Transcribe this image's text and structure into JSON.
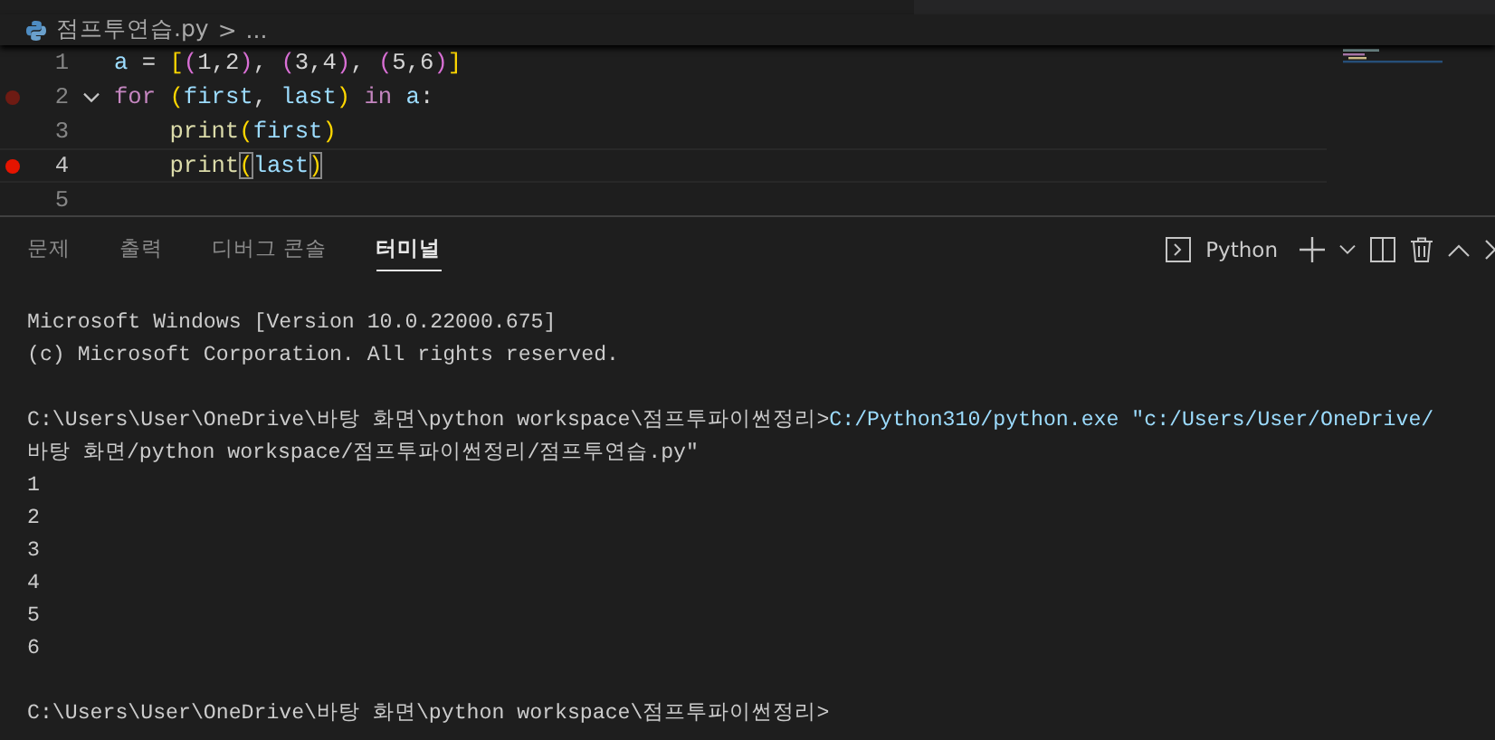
{
  "breadcrumb": {
    "file": "점프투연습.py",
    "separator": ">",
    "more": "..."
  },
  "editor": {
    "lines": [
      {
        "number": "1",
        "current": false,
        "fold": false,
        "tokens": [
          {
            "kind": "var",
            "text": "a"
          },
          {
            "kind": "op",
            "text": " = "
          },
          {
            "kind": "b1",
            "text": "["
          },
          {
            "kind": "b2",
            "text": "("
          },
          {
            "kind": "num",
            "text": "1,2"
          },
          {
            "kind": "b2",
            "text": ")"
          },
          {
            "kind": "op",
            "text": ", "
          },
          {
            "kind": "b2",
            "text": "("
          },
          {
            "kind": "num",
            "text": "3,4"
          },
          {
            "kind": "b2",
            "text": ")"
          },
          {
            "kind": "op",
            "text": ", "
          },
          {
            "kind": "b2",
            "text": "("
          },
          {
            "kind": "num",
            "text": "5,6"
          },
          {
            "kind": "b2",
            "text": ")"
          },
          {
            "kind": "b1",
            "text": "]"
          }
        ]
      },
      {
        "number": "2",
        "breakpoint": {
          "active": false
        },
        "current": false,
        "fold": true,
        "tokens": [
          {
            "kind": "kw",
            "text": "for "
          },
          {
            "kind": "b1",
            "text": "("
          },
          {
            "kind": "var",
            "text": "first"
          },
          {
            "kind": "op",
            "text": ", "
          },
          {
            "kind": "var",
            "text": "last"
          },
          {
            "kind": "b1",
            "text": ")"
          },
          {
            "kind": "kw",
            "text": " in "
          },
          {
            "kind": "var",
            "text": "a"
          },
          {
            "kind": "op",
            "text": ":"
          }
        ]
      },
      {
        "number": "3",
        "current": false,
        "fold": false,
        "tokens": [
          {
            "kind": "fn",
            "text": "    print"
          },
          {
            "kind": "b1",
            "text": "("
          },
          {
            "kind": "var",
            "text": "first"
          },
          {
            "kind": "b1",
            "text": ")"
          }
        ]
      },
      {
        "number": "4",
        "breakpoint": {
          "active": true
        },
        "current": true,
        "fold": false,
        "tokens": [
          {
            "kind": "fn",
            "text": "    print"
          },
          {
            "kind": "match",
            "text": "("
          },
          {
            "kind": "var",
            "text": "last"
          },
          {
            "kind": "match",
            "text": ")"
          }
        ]
      },
      {
        "number": "5",
        "current": false,
        "fold": false
      }
    ]
  },
  "panel": {
    "tabs": [
      {
        "label": "문제",
        "selected": false
      },
      {
        "label": "출력",
        "selected": false
      },
      {
        "label": "디버그 콘솔",
        "selected": false
      },
      {
        "label": "터미널",
        "selected": true
      }
    ],
    "terminal_name": "Python",
    "terminal_lines": [
      {
        "segments": [
          {
            "kind": "plain",
            "text": "Microsoft Windows [Version 10.0.22000.675]"
          }
        ]
      },
      {
        "segments": [
          {
            "kind": "plain",
            "text": "(c) Microsoft Corporation. All rights reserved."
          }
        ]
      },
      {
        "space_before": true,
        "segments": [
          {
            "kind": "plain",
            "text": "C:\\Users\\User\\OneDrive\\바탕 화면\\python workspace\\점프투파이썬정리>"
          },
          {
            "kind": "command",
            "text": "C:/Python310/python.exe \"c:/Users/User/OneDrive/"
          }
        ]
      },
      {
        "segments": [
          {
            "kind": "plain",
            "text": "바탕 화면/python workspace/점프투파이썬정리/점프투연습.py\""
          }
        ]
      },
      {
        "segments": [
          {
            "kind": "plain",
            "text": "1"
          }
        ]
      },
      {
        "segments": [
          {
            "kind": "plain",
            "text": "2"
          }
        ]
      },
      {
        "segments": [
          {
            "kind": "plain",
            "text": "3"
          }
        ]
      },
      {
        "segments": [
          {
            "kind": "plain",
            "text": "4"
          }
        ]
      },
      {
        "segments": [
          {
            "kind": "plain",
            "text": "5"
          }
        ]
      },
      {
        "segments": [
          {
            "kind": "plain",
            "text": "6"
          }
        ]
      },
      {
        "space_before": true,
        "segments": [
          {
            "kind": "plain",
            "text": "C:\\Users\\User\\OneDrive\\바탕 화면\\python workspace\\점프투파이썬정리>"
          }
        ]
      }
    ]
  }
}
